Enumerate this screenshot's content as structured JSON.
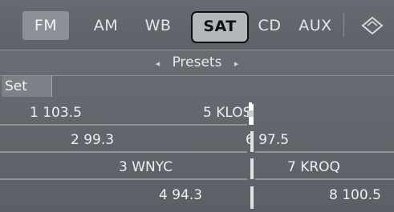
{
  "tabs": {
    "fm": "FM",
    "am": "AM",
    "wb": "WB",
    "sat": "SAT",
    "cd": "CD",
    "aux": "AUX",
    "active": "SAT"
  },
  "presets_header": {
    "label": "Presets",
    "left_arrow": "◂",
    "right_arrow": "▸"
  },
  "set_label": "Set",
  "presets": [
    {
      "label": "1 103.5"
    },
    {
      "label": "2 99.3"
    },
    {
      "label": "3 WNYC"
    },
    {
      "label": "4 94.3"
    },
    {
      "label": "5 KLOS"
    },
    {
      "label": "6 97.5"
    },
    {
      "label": "7 KROQ"
    },
    {
      "label": "8 100.5"
    }
  ],
  "colors": {
    "background": "#5e6469",
    "active_tab": "#b4b8bc",
    "highlight_tab": "#8b9196",
    "text": "#eef0f1"
  }
}
